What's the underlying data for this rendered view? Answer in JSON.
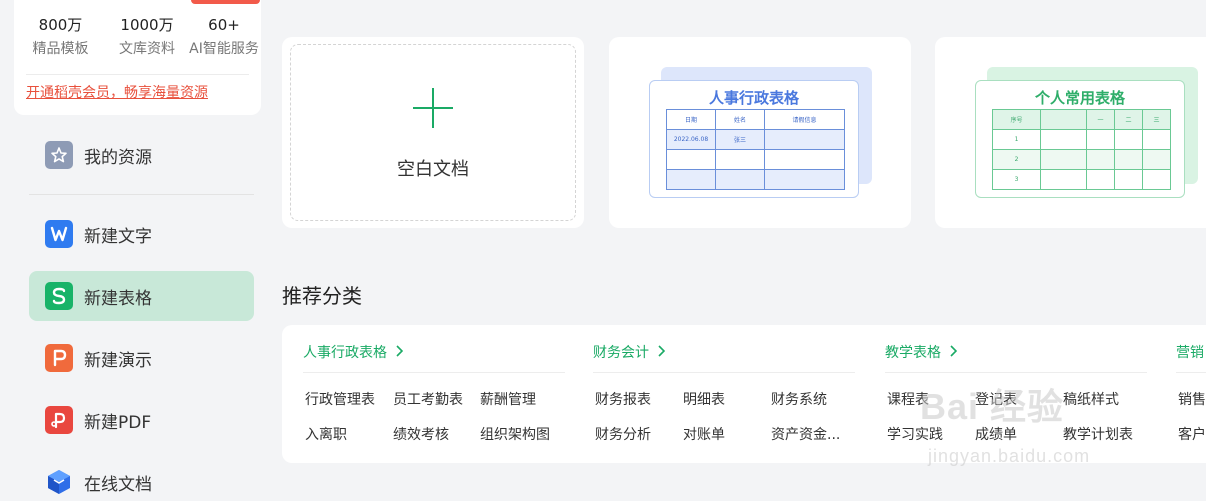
{
  "promo": {
    "stats": [
      {
        "num": "800万",
        "label": "精品模板"
      },
      {
        "num": "1000万",
        "label": "文库资料"
      },
      {
        "num": "60+",
        "label": "AI智能服务"
      }
    ],
    "link": "开通稻壳会员，畅享海量资源"
  },
  "sidebar": {
    "items": [
      {
        "label": "我的资源",
        "icon": "star-icon",
        "color": "#8e9bb5"
      },
      {
        "label": "新建文字",
        "icon": "W",
        "color": "#2f7bf0"
      },
      {
        "label": "新建表格",
        "icon": "S",
        "color": "#18b368"
      },
      {
        "label": "新建演示",
        "icon": "P",
        "color": "#f06a3c"
      },
      {
        "label": "新建PDF",
        "icon": "pdf-icon",
        "color": "#e9473f"
      },
      {
        "label": "在线文档",
        "icon": "cube-icon",
        "color": "#2f6ee8"
      }
    ],
    "active_index": 2
  },
  "cards": {
    "blank_label": "空白文档",
    "hr": {
      "title": "人事行政表格",
      "header": [
        "日期",
        "姓名",
        "请假信息"
      ],
      "row1": [
        "2022.06.08",
        "张三",
        ""
      ]
    },
    "personal": {
      "title": "个人常用表格",
      "header": [
        "序号",
        "",
        "一",
        "二",
        "三"
      ],
      "rows": [
        "1",
        "2",
        "3"
      ]
    }
  },
  "recommend": {
    "title": "推荐分类",
    "categories": [
      {
        "title": "人事行政表格",
        "items": [
          "行政管理表",
          "员工考勤表",
          "薪酬管理",
          "入离职",
          "绩效考核",
          "组织架构图"
        ]
      },
      {
        "title": "财务会计",
        "items": [
          "财务报表",
          "明细表",
          "财务系统",
          "财务分析",
          "对账单",
          "资产资金..."
        ]
      },
      {
        "title": "教学表格",
        "items": [
          "课程表",
          "登记表",
          "稿纸样式",
          "学习实践",
          "成绩单",
          "教学计划表"
        ]
      },
      {
        "title": "营销",
        "items": [
          "销售",
          "",
          "",
          "客户",
          "",
          ""
        ]
      }
    ]
  },
  "watermark": {
    "big": "Bai 经验",
    "small": "jingyan.baidu.com"
  }
}
